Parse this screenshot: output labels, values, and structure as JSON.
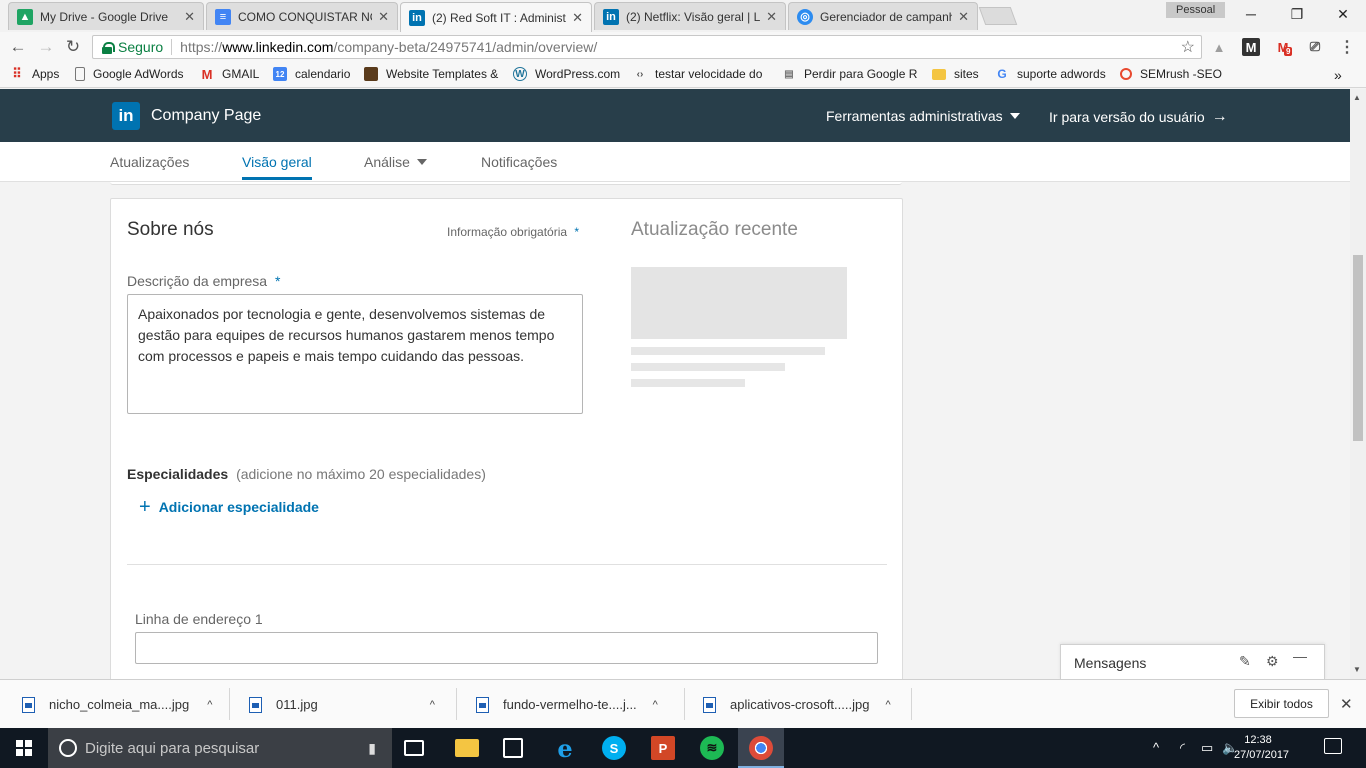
{
  "browser": {
    "tabs": [
      {
        "title": "My Drive - Google Drive",
        "icon": "google-drive-icon",
        "color": "#1fa463"
      },
      {
        "title": "COMO CONQUISTAR NO",
        "icon": "docs-icon",
        "color": "#4285f4"
      },
      {
        "title": "(2) Red Soft IT : Administ",
        "icon": "linkedin-icon",
        "color": "#0073b1",
        "active": true
      },
      {
        "title": "(2) Netflix: Visão geral | L",
        "icon": "linkedin-icon",
        "color": "#0073b1"
      },
      {
        "title": "Gerenciador de campanh",
        "icon": "campaign-manager-icon",
        "color": "#2d8cf0"
      }
    ],
    "profile": "Pessoal",
    "window_controls": {
      "minimize": "─",
      "maximize": "❐",
      "close": "✕"
    },
    "nav": {
      "back": "←",
      "forward": "→",
      "reload": "↻"
    },
    "secure_label": "Seguro",
    "url": {
      "scheme": "https://",
      "host": "www.linkedin.com",
      "path": "/company-beta/24975741/admin/overview/"
    },
    "star": "☆",
    "extensions": [
      {
        "name": "drive-ext-icon",
        "glyph": "▲",
        "color": "#9e9e9e"
      },
      {
        "name": "gmail-ext-icon",
        "glyph": "M",
        "color": "#333333"
      },
      {
        "name": "gmail-notifier-icon",
        "glyph": "M",
        "color": "#d93025",
        "badge": "9"
      },
      {
        "name": "cast-icon",
        "glyph": "⎚",
        "color": "#555555"
      },
      {
        "name": "menu-icon",
        "glyph": "⋮",
        "color": "#555555"
      }
    ],
    "bookmarks": [
      {
        "label": "Apps",
        "icon": "apps-grid-icon",
        "glyph": "⠿",
        "color": "#d93025"
      },
      {
        "label": "Google AdWords",
        "icon": "page-icon",
        "glyph": "▯",
        "color": "#777777"
      },
      {
        "label": "GMAIL",
        "icon": "gmail-icon",
        "glyph": "M",
        "color": "#d93025"
      },
      {
        "label": "calendario",
        "icon": "calendar-icon",
        "glyph": "12",
        "color": "#4285f4"
      },
      {
        "label": "Website Templates &",
        "icon": "template-icon",
        "glyph": "▪",
        "color": "#5a3b1c"
      },
      {
        "label": "WordPress.com",
        "icon": "wordpress-icon",
        "glyph": "W",
        "color": "#21759b"
      },
      {
        "label": "testar velocidade do",
        "icon": "speed-icon",
        "glyph": "‹›",
        "color": "#555555"
      },
      {
        "label": "Perdir para Google R",
        "icon": "page-icon",
        "glyph": "▤",
        "color": "#777777"
      },
      {
        "label": "sites",
        "icon": "folder-icon",
        "glyph": "▬",
        "color": "#f4c542"
      },
      {
        "label": "suporte adwords",
        "icon": "google-icon",
        "glyph": "G",
        "color": "#4285f4"
      },
      {
        "label": "SEMrush -SEO",
        "icon": "semrush-icon",
        "glyph": "O",
        "color": "#e8492f"
      }
    ],
    "bookmarks_overflow": "»"
  },
  "linkedin": {
    "logo": "in",
    "page_title": "Company Page",
    "admin_tools": "Ferramentas administrativas",
    "member_view": "Ir para versão do usuário",
    "member_view_arrow": "→",
    "subnav": [
      {
        "label": "Atualizações",
        "active": false
      },
      {
        "label": "Visão geral",
        "active": true
      },
      {
        "label": "Análise",
        "active": false,
        "dropdown": true
      },
      {
        "label": "Notificações",
        "active": false
      }
    ],
    "about": {
      "title": "Sobre nós",
      "required_note": "Informação obrigatória",
      "asterisk": "*",
      "recent_update_title": "Atualização recente",
      "description_label": "Descrição da empresa",
      "description_value": "Apaixonados por tecnologia e gente, desenvolvemos sistemas de gestão para equipes de recursos humanos gastarem menos tempo com processos e papeis e mais tempo cuidando das pessoas.",
      "specialties_label": "Especialidades",
      "specialties_hint": "(adicione no máximo 20 especialidades)",
      "add_specialty": "Adicionar especialidade",
      "add_symbol": "+",
      "address_label": "Linha de endereço 1",
      "address_value": ""
    },
    "messages": {
      "title": "Mensagens",
      "compose": "✎",
      "settings": "⚙",
      "minimize": "—"
    },
    "colors": {
      "navbar": "#283e4a",
      "brand": "#0073b1"
    }
  },
  "downloads": {
    "items": [
      {
        "name": "nicho_colmeia_ma....jpg"
      },
      {
        "name": "011.jpg"
      },
      {
        "name": "fundo-vermelho-te....j..."
      },
      {
        "name": "aplicativos-crosoft.....jpg"
      }
    ],
    "chevron": "^",
    "show_all": "Exibir todos",
    "close": "✕"
  },
  "taskbar": {
    "search_placeholder": "Digite aqui para pesquisar",
    "mic": "🎤",
    "apps": [
      {
        "name": "task-view-icon",
        "glyph": "❐",
        "bg": "transparent"
      },
      {
        "name": "file-explorer-icon",
        "glyph": "▬",
        "bg": "#f4c542"
      },
      {
        "name": "store-icon",
        "glyph": "▦",
        "bg": "transparent"
      },
      {
        "name": "edge-icon",
        "glyph": "e",
        "bg": "#1e7fd8"
      },
      {
        "name": "skype-icon",
        "glyph": "S",
        "bg": "#00aff0"
      },
      {
        "name": "powerpoint-icon",
        "glyph": "P",
        "bg": "#d24726"
      },
      {
        "name": "spotify-icon",
        "glyph": "≋",
        "bg": "#1db954"
      },
      {
        "name": "chrome-icon",
        "glyph": "◉",
        "bg": "#dd4b39"
      }
    ],
    "tray": {
      "chevron": "^",
      "network": "◜",
      "battery": "▭",
      "volume": "🔈"
    },
    "time": "12:38",
    "date": "27/07/2017"
  }
}
